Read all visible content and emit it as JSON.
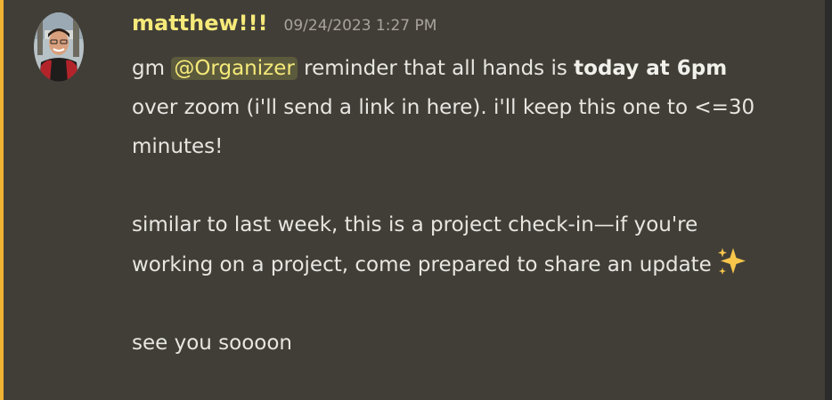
{
  "message": {
    "author": "matthew!!!",
    "timestamp": "09/24/2023 1:27 PM",
    "accent_color": "#f0b232",
    "mention_bg": "#5c5a3c",
    "line1_prefix": "gm ",
    "mention": "@Organizer",
    "line1_suffix": " reminder that all hands is ",
    "bold_text": "today at 6pm",
    "line1_rest": " over zoom (i'll send a link in here). i'll keep this one to <=30 minutes!",
    "paragraph2": "similar to last week, this is a project check-in—if you're working on a project, come prepared to share an update",
    "sparkles_icon": "sparkles-emoji",
    "paragraph3": "see you soooon"
  }
}
